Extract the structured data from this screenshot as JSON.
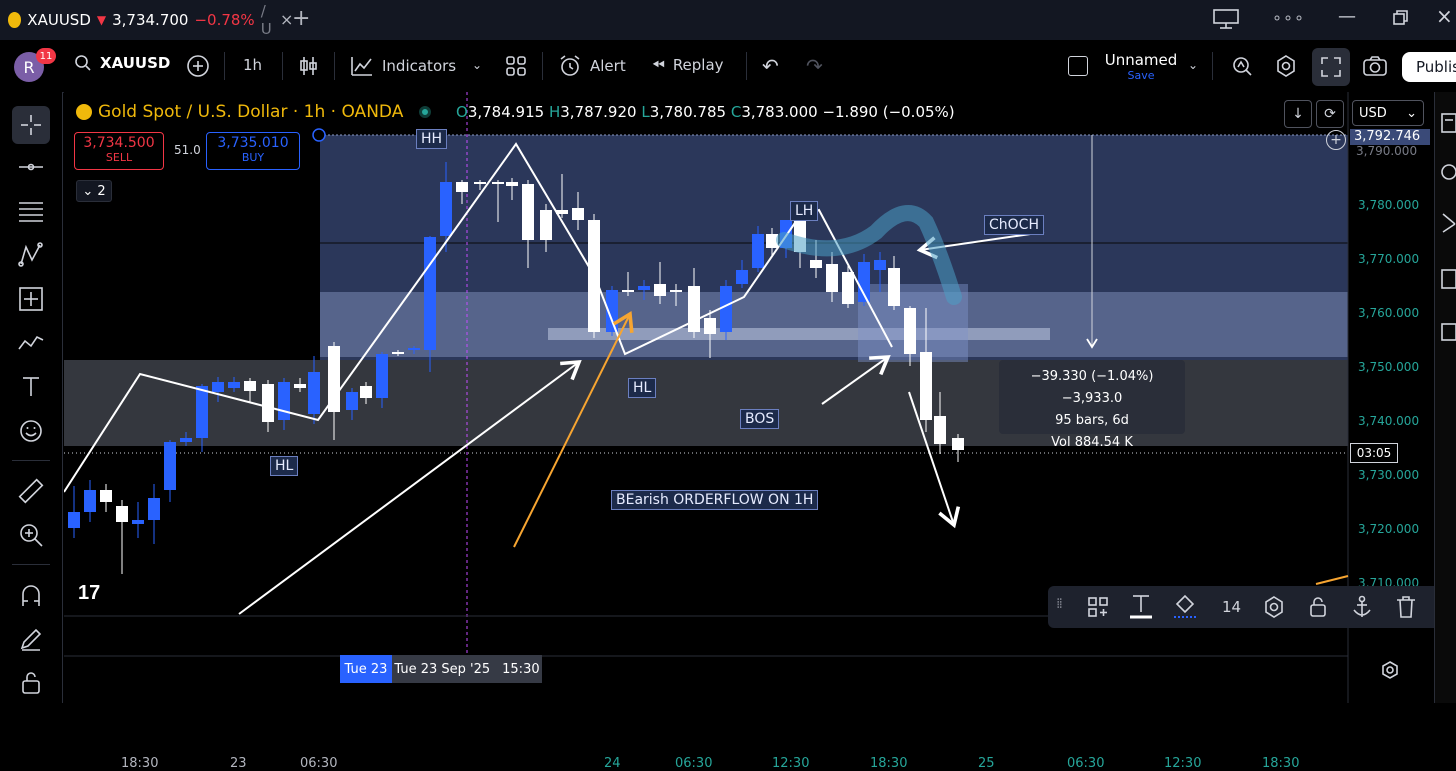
{
  "tab": {
    "symbol": "XAUUSD",
    "price": "3,734.700",
    "change": "−0.78%",
    "suffix": "/ U"
  },
  "toolbar": {
    "avatar_letter": "R",
    "notif_count": "11",
    "search_symbol": "XAUUSD",
    "interval": "1h",
    "indicators": "Indicators",
    "alert": "Alert",
    "replay": "Replay",
    "layout_name": "Unnamed",
    "save_label": "Save",
    "publish": "Publis"
  },
  "legend": {
    "title": "Gold Spot / U.S. Dollar · 1h · OANDA",
    "o_label": "O",
    "o": "3,784.915",
    "h_label": "H",
    "h": "3,787.920",
    "l_label": "L",
    "l": "3,780.785",
    "c_label": "C",
    "c": "3,783.000",
    "change": "−1.890 (−0.05%)"
  },
  "trade": {
    "sell_price": "3,734.500",
    "sell_label": "SELL",
    "spread": "51.0",
    "buy_price": "3,735.010",
    "buy_label": "BUY",
    "collapsed_count": "2"
  },
  "currency": "USD",
  "price_axis": {
    "top_marker": "3,792.746",
    "labels": [
      "3,790.000",
      "3,780.000",
      "3,770.000",
      "3,760.000",
      "3,750.000",
      "3,740.000",
      "3,730.000",
      "3,720.000",
      "3,710.000"
    ],
    "countdown": "03:05"
  },
  "time_axis": {
    "labels": [
      "18:30",
      "23",
      "06:30",
      "24",
      "06:30",
      "12:30",
      "18:30",
      "25",
      "06:30",
      "12:30",
      "18:30"
    ],
    "highlight_short": "Tue 23",
    "highlight_long": "Tue 23 Sep '25",
    "highlight_time": "15:30"
  },
  "annotations": {
    "hh": "HH",
    "lh": "LH",
    "choch": "ChOCH",
    "hl_left": "HL",
    "hl_mid": "HL",
    "bos": "BOS",
    "orderflow": "BEarish ORDERFLOW ON 1H"
  },
  "measure": {
    "line1": "−39.330 (−1.04%) −3,933.0",
    "line2": "95 bars, 6d",
    "line3": "Vol 884.54 K"
  },
  "float_toolbar": {
    "font_size": "14"
  },
  "colors": {
    "bull": "#2962ff",
    "bear": "#ffffff",
    "sell": "#f23645",
    "buy": "#2962ff",
    "zone": "#3a4a78",
    "accent_green": "#26a69a"
  }
}
